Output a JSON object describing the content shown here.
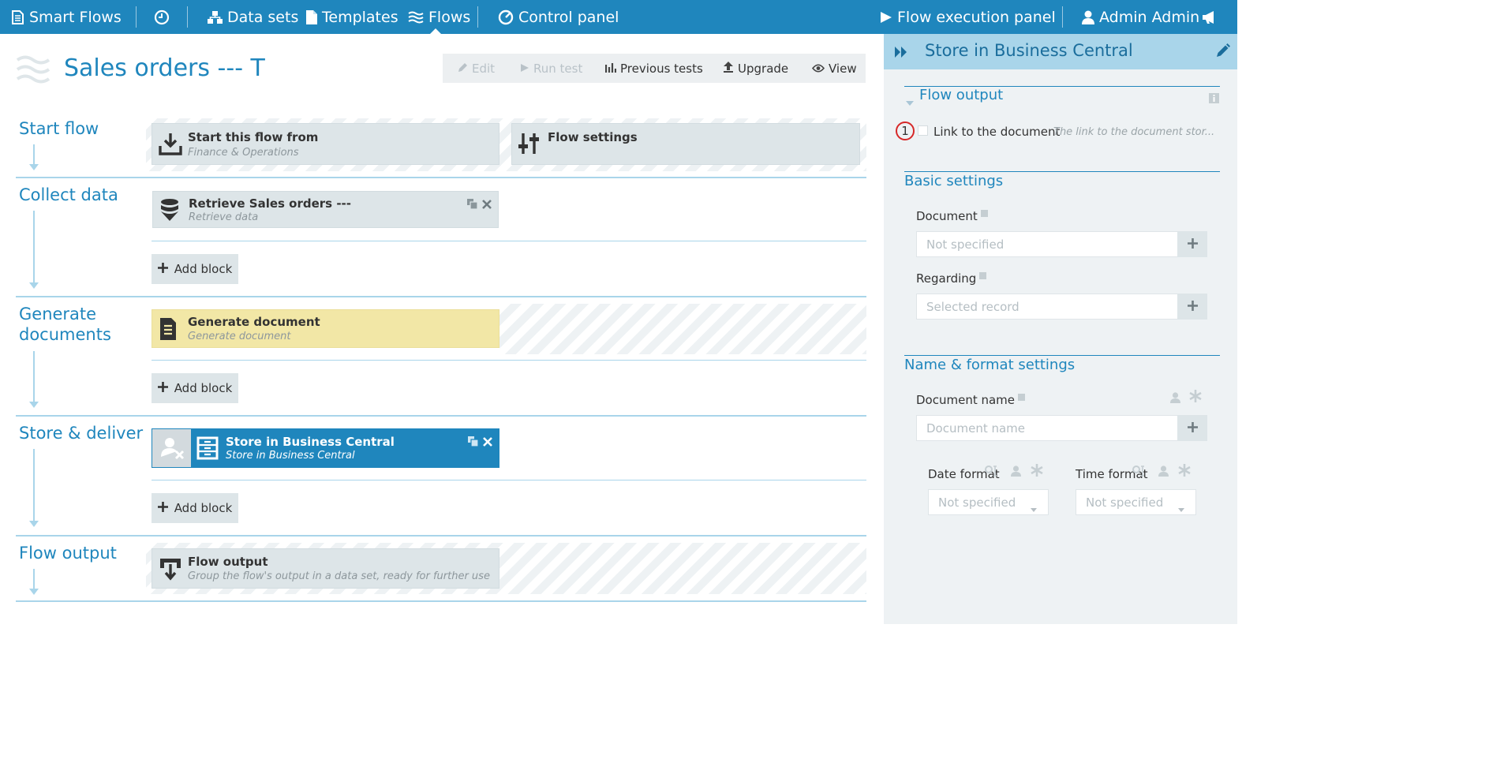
{
  "nav": {
    "brand": "Smart Flows",
    "datasets": "Data sets",
    "templates": "Templates",
    "flows": "Flows",
    "control_panel": "Control panel",
    "flow_execution_panel": "Flow execution panel",
    "user": "Admin Admin"
  },
  "page": {
    "title": "Sales orders --- T"
  },
  "toolbar": {
    "edit": "Edit",
    "run_test": "Run test",
    "previous_tests": "Previous tests",
    "upgrade": "Upgrade",
    "view": "View"
  },
  "stages": {
    "start": {
      "label": "Start flow",
      "blocks": [
        {
          "title": "Start this flow from",
          "subtitle": "Finance & Operations"
        },
        {
          "title": "Flow settings",
          "subtitle": ""
        }
      ]
    },
    "collect": {
      "label": "Collect data",
      "blocks": [
        {
          "title": "Retrieve Sales orders ---",
          "subtitle": "Retrieve data"
        }
      ],
      "add_label": "Add block"
    },
    "generate": {
      "label_line1": "Generate",
      "label_line2": "documents",
      "blocks": [
        {
          "title": "Generate document",
          "subtitle": "Generate document"
        }
      ],
      "add_label": "Add block"
    },
    "store": {
      "label": "Store & deliver",
      "blocks": [
        {
          "title": "Store in Business Central",
          "subtitle": "Store in Business Central"
        }
      ],
      "add_label": "Add block"
    },
    "output": {
      "label": "Flow output",
      "blocks": [
        {
          "title": "Flow output",
          "subtitle": "Group the flow's output in a data set, ready for further use"
        }
      ]
    }
  },
  "panel": {
    "title": "Store in Business Central",
    "flow_output": {
      "title": "Flow output",
      "badge": "1",
      "item_label": "Link to the document",
      "item_desc": "The link to the document stor..."
    },
    "basic": {
      "title": "Basic settings",
      "document_label": "Document",
      "document_placeholder": "Not specified",
      "regarding_label": "Regarding",
      "regarding_placeholder": "Selected record"
    },
    "name_format": {
      "title": "Name & format settings",
      "document_name_label": "Document name",
      "document_name_placeholder": "Document name",
      "date_format_label": "Date format",
      "date_format_value": "Not specified",
      "time_format_label": "Time format",
      "time_format_value": "Not specified"
    }
  },
  "colors": {
    "primary": "#1f86bd",
    "panel_header": "#a9d5ea",
    "generate_block": "#f2e7a6",
    "badge_ring": "#d62828"
  }
}
